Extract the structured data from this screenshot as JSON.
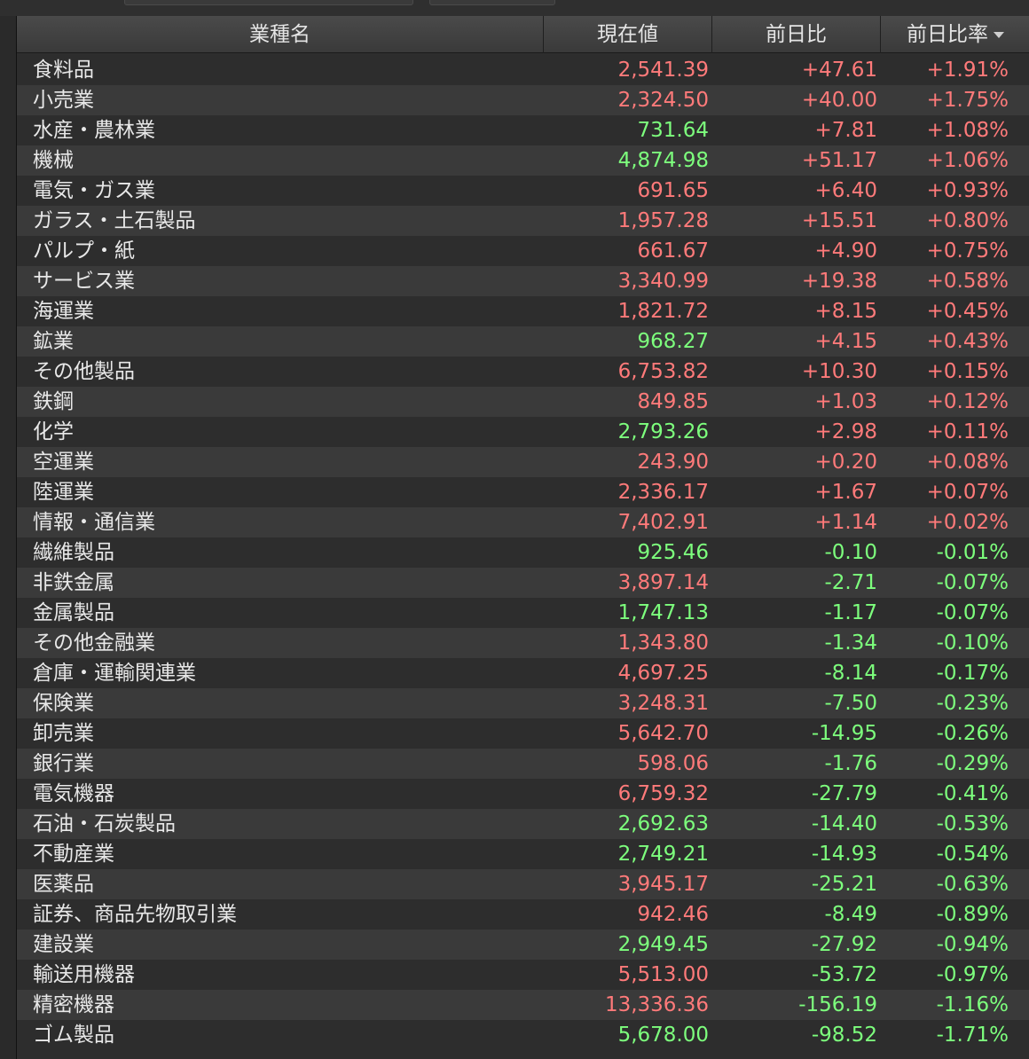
{
  "colors": {
    "positive": "#ff7a7a",
    "negative": "#7dff7d",
    "text": "#e8e8e8"
  },
  "header": {
    "name": "業種名",
    "price": "現在値",
    "change": "前日比",
    "change_pct": "前日比率",
    "sort_icon": "sort-descending-icon"
  },
  "rows": [
    {
      "name": "食料品",
      "price": "2,541.39",
      "price_dir": "up",
      "change": "+47.61",
      "pct": "+1.91%",
      "dir": "up"
    },
    {
      "name": "小売業",
      "price": "2,324.50",
      "price_dir": "up",
      "change": "+40.00",
      "pct": "+1.75%",
      "dir": "up"
    },
    {
      "name": "水産・農林業",
      "price": "731.64",
      "price_dir": "dn",
      "change": "+7.81",
      "pct": "+1.08%",
      "dir": "up"
    },
    {
      "name": "機械",
      "price": "4,874.98",
      "price_dir": "dn",
      "change": "+51.17",
      "pct": "+1.06%",
      "dir": "up"
    },
    {
      "name": "電気・ガス業",
      "price": "691.65",
      "price_dir": "up",
      "change": "+6.40",
      "pct": "+0.93%",
      "dir": "up"
    },
    {
      "name": "ガラス・土石製品",
      "price": "1,957.28",
      "price_dir": "up",
      "change": "+15.51",
      "pct": "+0.80%",
      "dir": "up"
    },
    {
      "name": "パルプ・紙",
      "price": "661.67",
      "price_dir": "up",
      "change": "+4.90",
      "pct": "+0.75%",
      "dir": "up"
    },
    {
      "name": "サービス業",
      "price": "3,340.99",
      "price_dir": "up",
      "change": "+19.38",
      "pct": "+0.58%",
      "dir": "up"
    },
    {
      "name": "海運業",
      "price": "1,821.72",
      "price_dir": "up",
      "change": "+8.15",
      "pct": "+0.45%",
      "dir": "up"
    },
    {
      "name": "鉱業",
      "price": "968.27",
      "price_dir": "dn",
      "change": "+4.15",
      "pct": "+0.43%",
      "dir": "up"
    },
    {
      "name": "その他製品",
      "price": "6,753.82",
      "price_dir": "up",
      "change": "+10.30",
      "pct": "+0.15%",
      "dir": "up"
    },
    {
      "name": "鉄鋼",
      "price": "849.85",
      "price_dir": "up",
      "change": "+1.03",
      "pct": "+0.12%",
      "dir": "up"
    },
    {
      "name": "化学",
      "price": "2,793.26",
      "price_dir": "dn",
      "change": "+2.98",
      "pct": "+0.11%",
      "dir": "up"
    },
    {
      "name": "空運業",
      "price": "243.90",
      "price_dir": "up",
      "change": "+0.20",
      "pct": "+0.08%",
      "dir": "up"
    },
    {
      "name": "陸運業",
      "price": "2,336.17",
      "price_dir": "up",
      "change": "+1.67",
      "pct": "+0.07%",
      "dir": "up"
    },
    {
      "name": "情報・通信業",
      "price": "7,402.91",
      "price_dir": "up",
      "change": "+1.14",
      "pct": "+0.02%",
      "dir": "up"
    },
    {
      "name": "繊維製品",
      "price": "925.46",
      "price_dir": "dn",
      "change": "-0.10",
      "pct": "-0.01%",
      "dir": "dn"
    },
    {
      "name": "非鉄金属",
      "price": "3,897.14",
      "price_dir": "up",
      "change": "-2.71",
      "pct": "-0.07%",
      "dir": "dn"
    },
    {
      "name": "金属製品",
      "price": "1,747.13",
      "price_dir": "dn",
      "change": "-1.17",
      "pct": "-0.07%",
      "dir": "dn"
    },
    {
      "name": "その他金融業",
      "price": "1,343.80",
      "price_dir": "up",
      "change": "-1.34",
      "pct": "-0.10%",
      "dir": "dn"
    },
    {
      "name": "倉庫・運輸関連業",
      "price": "4,697.25",
      "price_dir": "up",
      "change": "-8.14",
      "pct": "-0.17%",
      "dir": "dn"
    },
    {
      "name": "保険業",
      "price": "3,248.31",
      "price_dir": "up",
      "change": "-7.50",
      "pct": "-0.23%",
      "dir": "dn"
    },
    {
      "name": "卸売業",
      "price": "5,642.70",
      "price_dir": "up",
      "change": "-14.95",
      "pct": "-0.26%",
      "dir": "dn"
    },
    {
      "name": "銀行業",
      "price": "598.06",
      "price_dir": "up",
      "change": "-1.76",
      "pct": "-0.29%",
      "dir": "dn"
    },
    {
      "name": "電気機器",
      "price": "6,759.32",
      "price_dir": "up",
      "change": "-27.79",
      "pct": "-0.41%",
      "dir": "dn"
    },
    {
      "name": "石油・石炭製品",
      "price": "2,692.63",
      "price_dir": "dn",
      "change": "-14.40",
      "pct": "-0.53%",
      "dir": "dn"
    },
    {
      "name": "不動産業",
      "price": "2,749.21",
      "price_dir": "dn",
      "change": "-14.93",
      "pct": "-0.54%",
      "dir": "dn"
    },
    {
      "name": "医薬品",
      "price": "3,945.17",
      "price_dir": "up",
      "change": "-25.21",
      "pct": "-0.63%",
      "dir": "dn"
    },
    {
      "name": "証券、商品先物取引業",
      "price": "942.46",
      "price_dir": "up",
      "change": "-8.49",
      "pct": "-0.89%",
      "dir": "dn"
    },
    {
      "name": "建設業",
      "price": "2,949.45",
      "price_dir": "dn",
      "change": "-27.92",
      "pct": "-0.94%",
      "dir": "dn"
    },
    {
      "name": "輸送用機器",
      "price": "5,513.00",
      "price_dir": "up",
      "change": "-53.72",
      "pct": "-0.97%",
      "dir": "dn"
    },
    {
      "name": "精密機器",
      "price": "13,336.36",
      "price_dir": "up",
      "change": "-156.19",
      "pct": "-1.16%",
      "dir": "dn"
    },
    {
      "name": "ゴム製品",
      "price": "5,678.00",
      "price_dir": "dn",
      "change": "-98.52",
      "pct": "-1.71%",
      "dir": "dn"
    }
  ]
}
